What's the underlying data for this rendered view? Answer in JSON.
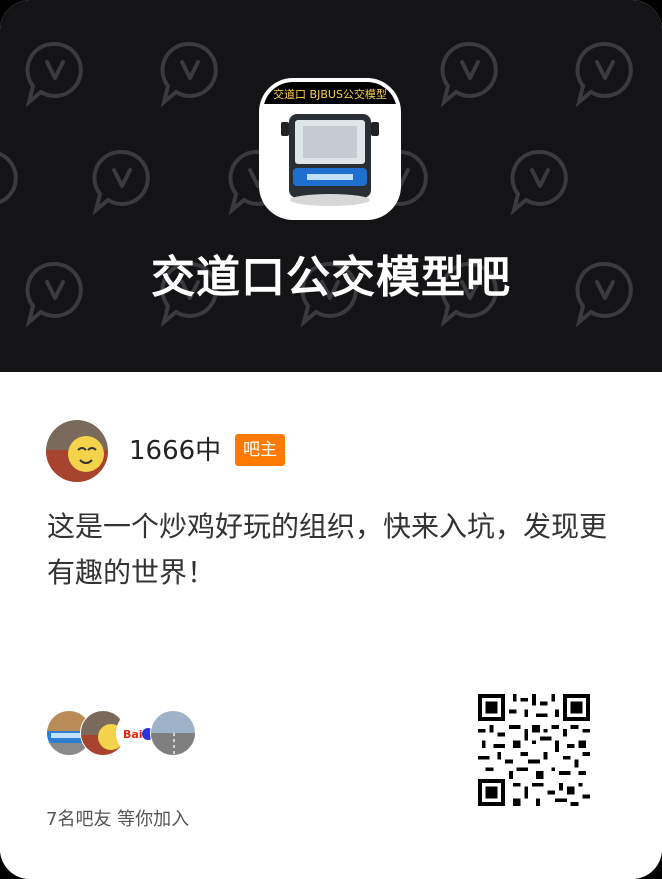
{
  "forum": {
    "name": "交道口公交模型吧",
    "cover_banner": "交道口 BJBUS公交模型"
  },
  "owner": {
    "name": "1666中",
    "badge": "吧主"
  },
  "slogan": "这是一个炒鸡好玩的组织，快来入坑，发现更有趣的世界！",
  "members": {
    "text": "7名吧友 等你加入",
    "avatars": [
      "bus-photo",
      "cartoon-face",
      "baidu-logo",
      "road-photo"
    ]
  },
  "colors": {
    "header_bg": "#141416",
    "badge": "#ff7a00",
    "text_dark": "#333333"
  },
  "icons": [
    "header-watermark-icon",
    "qr-code"
  ]
}
